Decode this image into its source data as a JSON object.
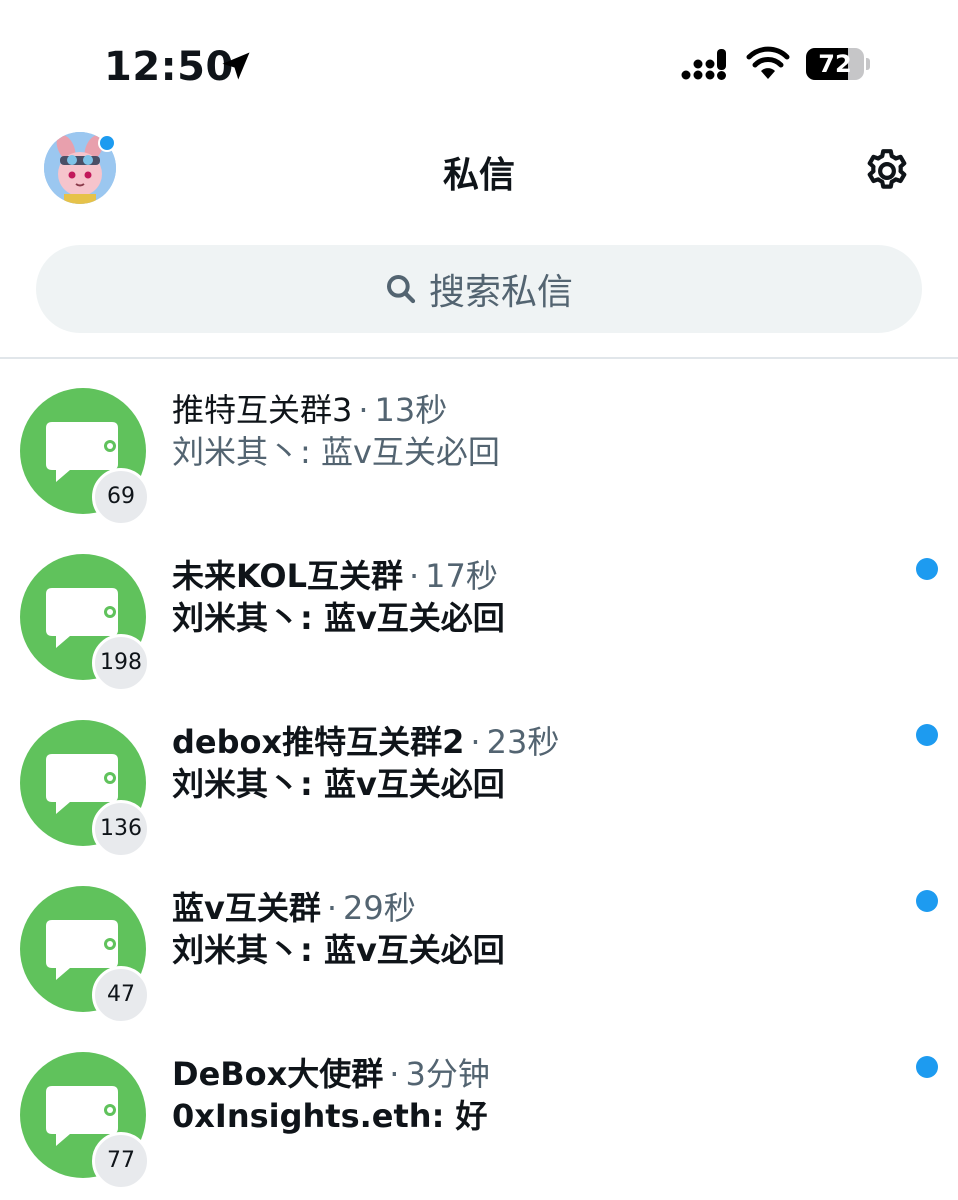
{
  "status_bar": {
    "time": "12:50",
    "battery": "72",
    "battery_level": 0.72
  },
  "header": {
    "title": "私信",
    "has_notification": true
  },
  "search": {
    "placeholder": "搜索私信"
  },
  "conversations": [
    {
      "name": "推特互关群3",
      "time": "13秒",
      "message": "刘米其丶: 蓝v互关必回",
      "count": "69",
      "unread": false
    },
    {
      "name": "未来KOL互关群",
      "time": "17秒",
      "message": "刘米其丶: 蓝v互关必回",
      "count": "198",
      "unread": true
    },
    {
      "name": "debox推特互关群2",
      "time": "23秒",
      "message": "刘米其丶: 蓝v互关必回",
      "count": "136",
      "unread": true
    },
    {
      "name": "蓝v互关群",
      "time": "29秒",
      "message": "刘米其丶: 蓝v互关必回",
      "count": "47",
      "unread": true
    },
    {
      "name": "DeBox大使群",
      "time": "3分钟",
      "message": "0xInsights.eth: 好",
      "count": "77",
      "unread": true
    }
  ],
  "colors": {
    "accent": "#1d9bf0",
    "group_avatar": "#60c25c",
    "secondary_text": "#536471"
  },
  "icons": {
    "location": "location-arrow-icon",
    "signal": "cellular-signal-icon",
    "wifi": "wifi-icon",
    "settings": "gear-icon",
    "search": "search-icon",
    "group": "chat-bubble-icon"
  }
}
